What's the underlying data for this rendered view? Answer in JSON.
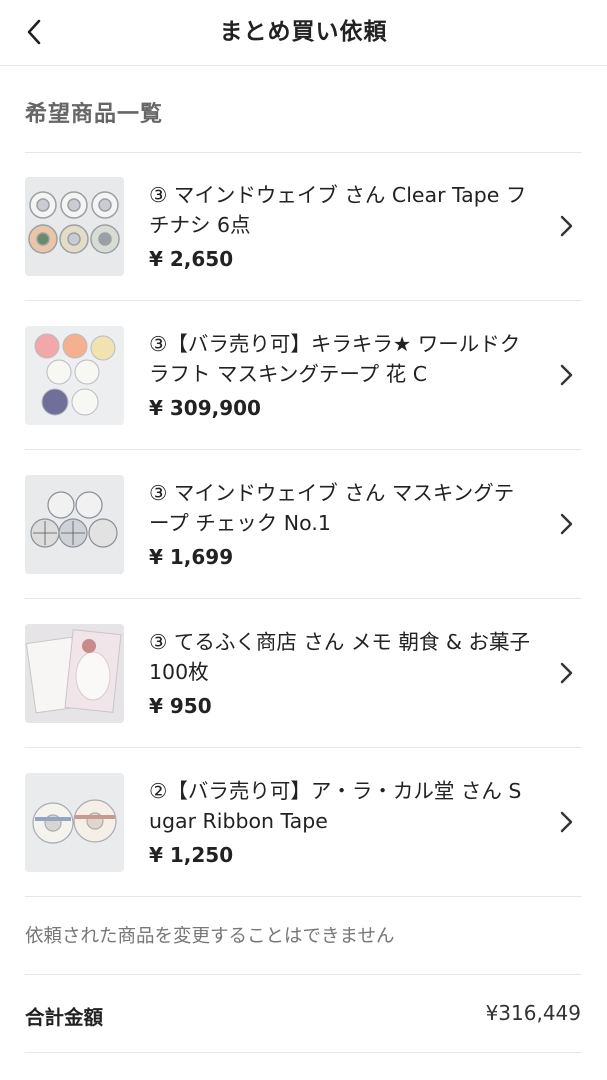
{
  "header": {
    "title": "まとめ買い依頼"
  },
  "section_title": "希望商品一覧",
  "items": [
    {
      "name": "③ マインドウェイブ さん Clear Tape フチナシ 6点",
      "price": "¥ 2,650",
      "thumb": "clear-tape-thumbnail"
    },
    {
      "name": "③【バラ売り可】キラキラ★ ワールドクラフト マスキングテープ 花 C",
      "price": "¥ 309,900",
      "thumb": "masking-tape-thumbnail"
    },
    {
      "name": "③ マインドウェイブ さん マスキングテープ チェック No.1",
      "price": "¥ 1,699",
      "thumb": "check-tape-thumbnail"
    },
    {
      "name": "③ てるふく商店 さん メモ 朝食 & お菓子 100枚",
      "price": "¥ 950",
      "thumb": "memo-pad-thumbnail"
    },
    {
      "name": "②【バラ売り可】ア・ラ・カル堂 さん Sugar Ribbon Tape",
      "price": "¥ 1,250",
      "thumb": "ribbon-tape-thumbnail"
    }
  ],
  "note": "依頼された商品を変更することはできません",
  "total": {
    "label": "合計金額",
    "value": "¥316,449"
  },
  "colors": {
    "text": "#222222",
    "subtext": "#666666",
    "divider": "#e6e6e6",
    "background": "#ffffff"
  }
}
